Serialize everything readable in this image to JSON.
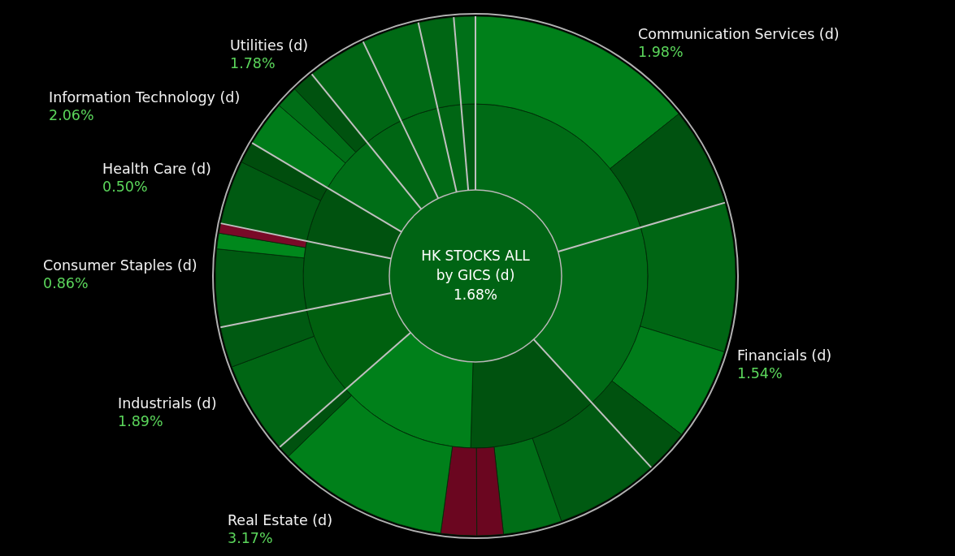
{
  "chart": {
    "title_lines": [
      "HK STOCKS ALL",
      "by GICS (d)"
    ],
    "total_change": "1.68%",
    "sectors": [
      {
        "label": "Communication Services (d)",
        "change": "1.98%"
      },
      {
        "label": "Utilities (d)",
        "change": "1.78%"
      },
      {
        "label": "Information Technology (d)",
        "change": "2.06%"
      },
      {
        "label": "Health Care (d)",
        "change": "0.50%"
      },
      {
        "label": "Consumer Staples (d)",
        "change": "0.86%"
      },
      {
        "label": "Financials (d)",
        "change": "1.54%"
      },
      {
        "label": "Industrials (d)",
        "change": "1.89%"
      },
      {
        "label": "Real Estate (d)",
        "change": "3.17%"
      }
    ]
  }
}
